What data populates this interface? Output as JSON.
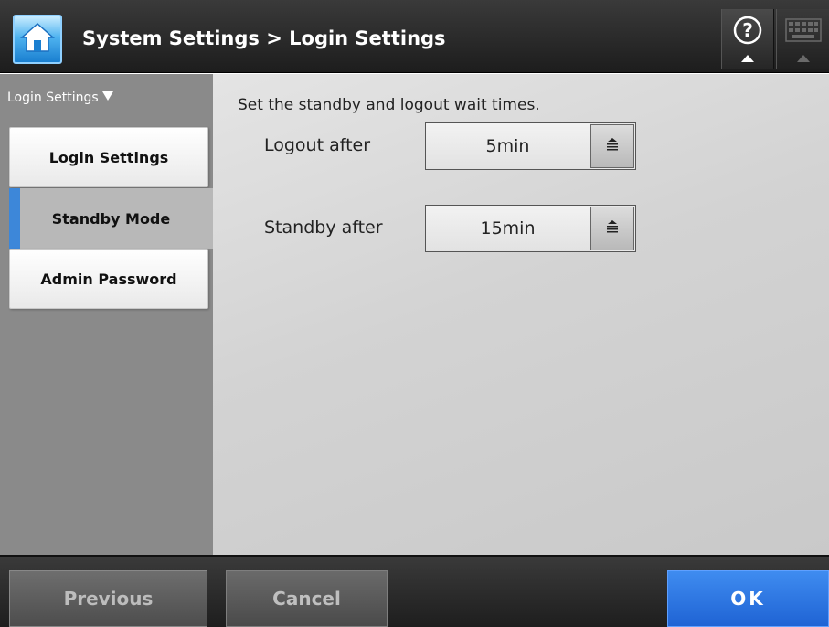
{
  "header": {
    "title": "System Settings > Login Settings",
    "home_icon": "home-icon",
    "help_icon": "help-icon",
    "keyboard_icon": "keyboard-icon"
  },
  "sidebar": {
    "header": "Login Settings",
    "header_icon": "triangle-down-icon",
    "items": [
      {
        "label": "Login Settings",
        "selected": false
      },
      {
        "label": "Standby Mode",
        "selected": true
      },
      {
        "label": "Admin Password",
        "selected": false
      }
    ]
  },
  "main": {
    "instructions": "Set the standby and logout wait times.",
    "fields": [
      {
        "label": "Logout after",
        "value": "5min"
      },
      {
        "label": "Standby after",
        "value": "15min"
      }
    ]
  },
  "footer": {
    "previous_label": "Previous",
    "cancel_label": "Cancel",
    "ok_label": "OK"
  },
  "colors": {
    "accent": "#3d87d9",
    "ok_button": "#2a72e0",
    "sidebar_bg": "#8a8a8a",
    "header_bg": "#2a2a2a"
  }
}
